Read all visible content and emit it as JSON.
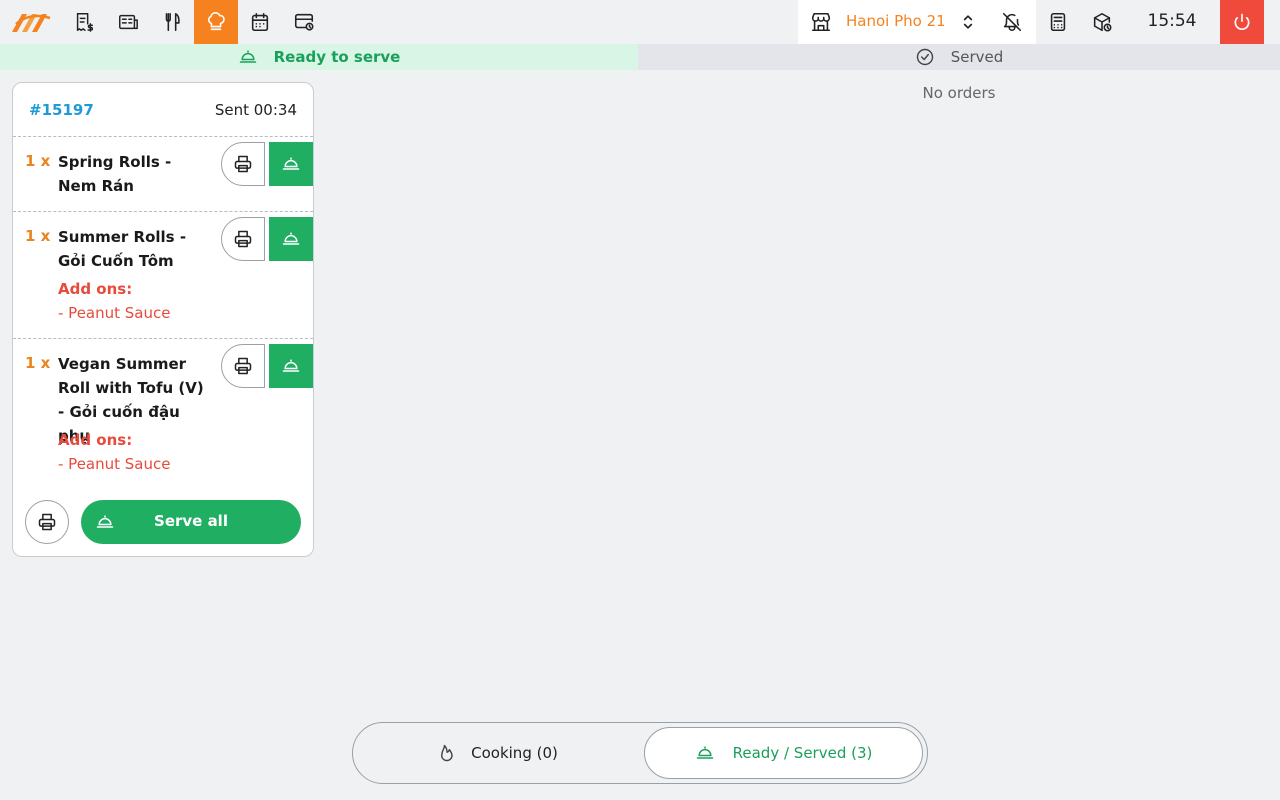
{
  "topbar": {
    "nav": [
      {
        "icon": "receipt-dollar-icon"
      },
      {
        "icon": "menu-list-icon"
      },
      {
        "icon": "fork-knife-icon"
      },
      {
        "icon": "chef-hat-icon",
        "active": true
      },
      {
        "icon": "calendar-icon"
      },
      {
        "icon": "card-clock-icon"
      }
    ],
    "store_name": "Hanoi Pho 21",
    "clock": "15:54",
    "accent_color": "#f5821f"
  },
  "sections": {
    "ready_label": "Ready to serve",
    "served_label": "Served",
    "served_empty": "No orders"
  },
  "order": {
    "number": "#15197",
    "sent": "Sent 00:34",
    "items": [
      {
        "qty": "1 x",
        "name": "Spring Rolls - Nem Rán",
        "addons_label": "",
        "addons": []
      },
      {
        "qty": "1 x",
        "name": "Summer Rolls - Gỏi Cuốn Tôm",
        "addons_label": "Add ons:",
        "addons": [
          "- Peanut Sauce"
        ]
      },
      {
        "qty": "1 x",
        "name": "Vegan Summer Roll with Tofu (V) - Gỏi cuốn đậu phụ",
        "addons_label": "Add ons:",
        "addons": [
          "- Peanut Sauce"
        ]
      }
    ],
    "serve_all_label": "Serve all"
  },
  "switch": {
    "cooking_label": "Cooking (0)",
    "ready_label": "Ready / Served (3)"
  },
  "colors": {
    "green": "#1fae62",
    "orange": "#e8851f",
    "red": "#e84a3c",
    "blue": "#1e9ad6"
  }
}
